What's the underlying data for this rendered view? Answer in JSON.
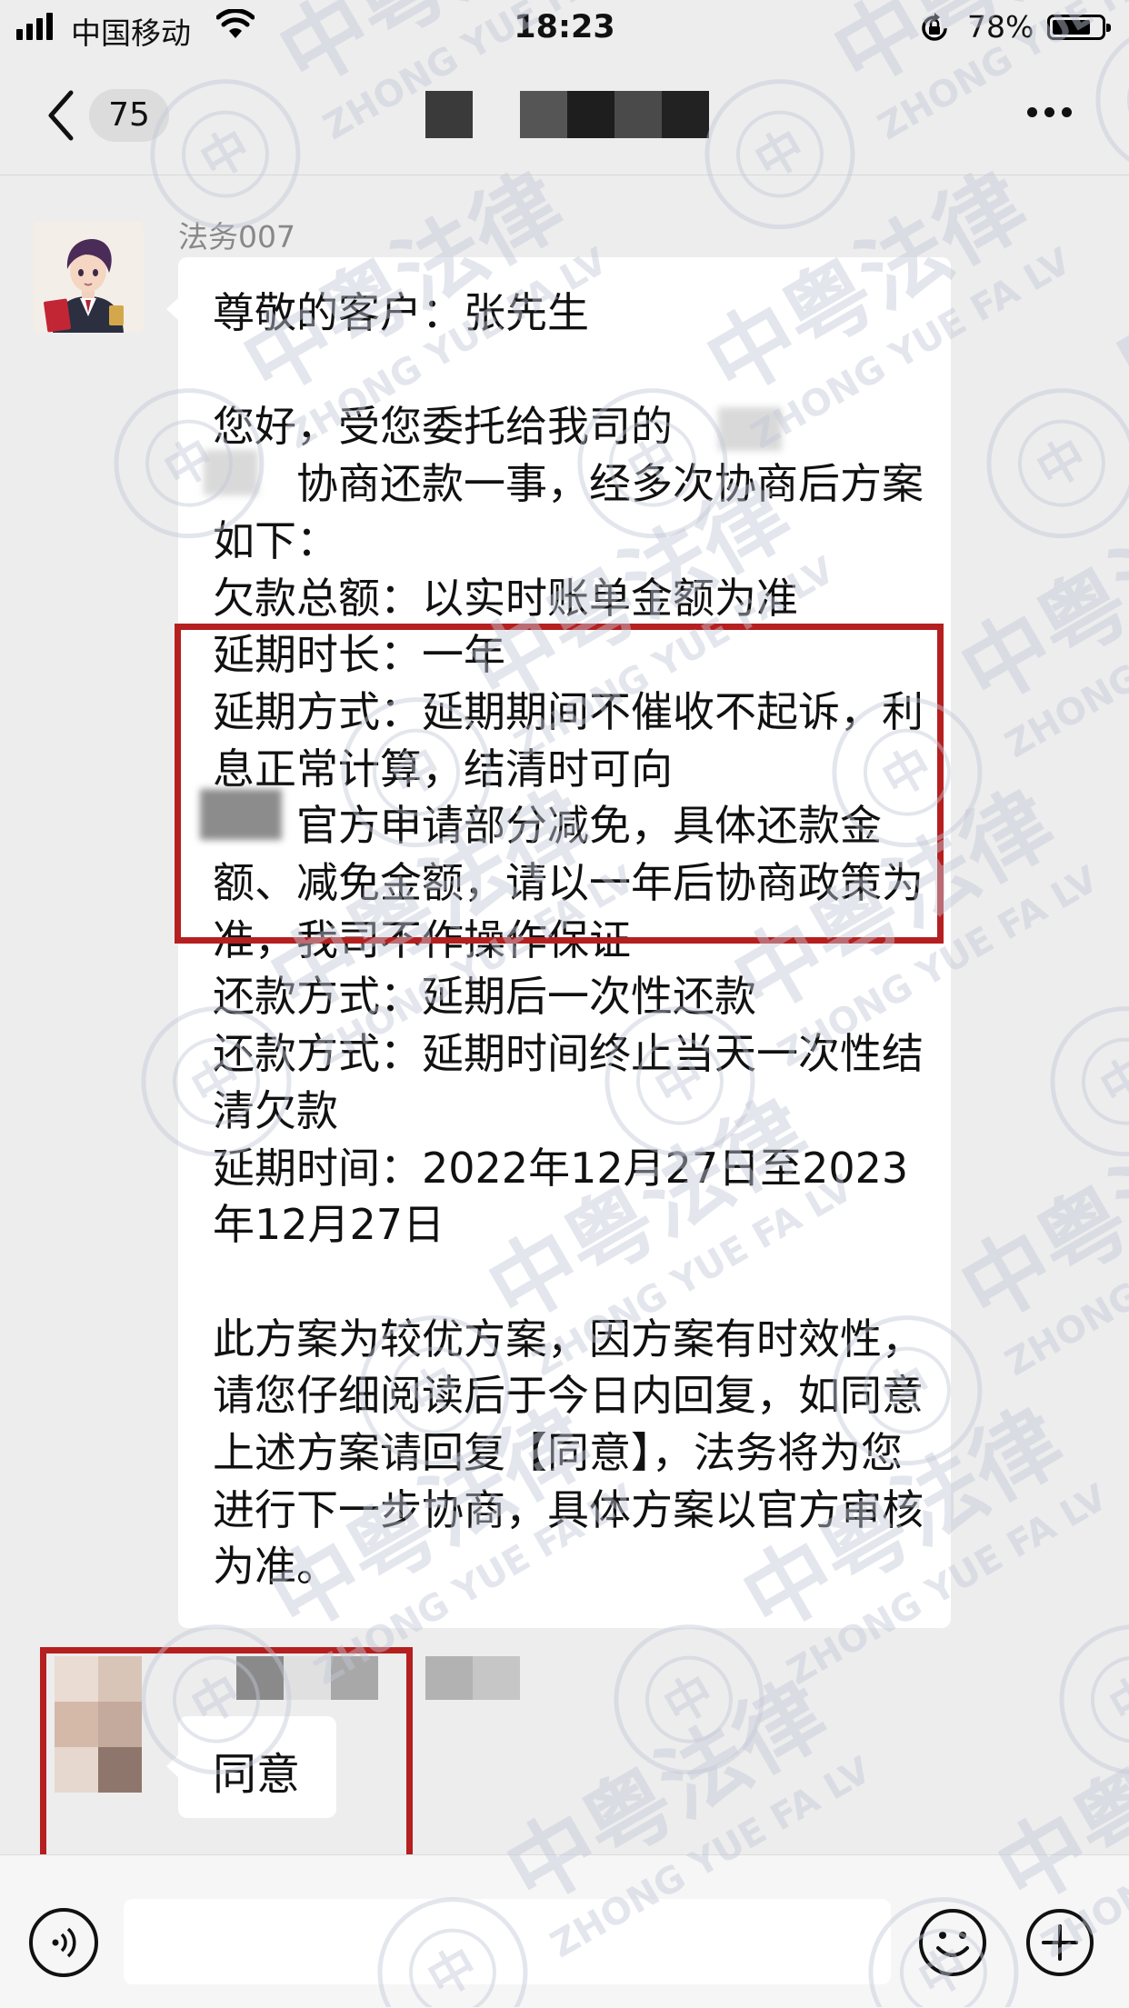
{
  "status_bar": {
    "carrier": "中国移动",
    "time": "18:23",
    "battery_percent": "78%",
    "battery_level": 0.78
  },
  "nav": {
    "unread_count": "75"
  },
  "messages": [
    {
      "sender": "法务007",
      "text": "尊敬的客户：张先生\n\n您好，受您委托给我司的\n　　协商还款一事，经多次协商后方案如下：\n欠款总额：以实时账单金额为准\n延期时长：一年\n延期方式：延期期间不催收不起诉，利息正常计算，结清时可向\n　　官方申请部分减免，具体还款金额、减免金额，请以一年后协商政策为准，我司不作操作保证\n还款方式：延期后一次性还款\n还款方式：延期时间终止当天一次性结清欠款\n延期时间：2022年12月27日至2023年12月27日\n\n此方案为较优方案，因方案有时效性，请您仔细阅读后于今日内回复，如同意上述方案请回复【同意】，法务将为您进行下一步协商，具体方案以官方审核为准。"
    },
    {
      "text": "同意"
    }
  ],
  "watermark": {
    "cn": "中粤法律",
    "en": "ZHONG YUE FA LV",
    "seal_char": "中",
    "color": "#c4c9d8"
  },
  "colors": {
    "highlight_border": "#b51f1f",
    "background": "#ededed",
    "bubble": "#ffffff"
  }
}
